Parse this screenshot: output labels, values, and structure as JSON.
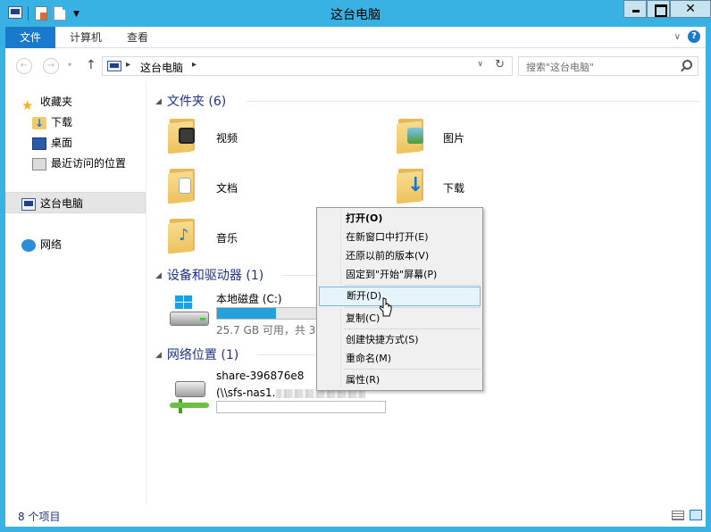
{
  "window": {
    "title": "这台电脑",
    "close_glyph": "✕"
  },
  "ribbon": {
    "tabs": [
      "文件",
      "计算机",
      "查看"
    ],
    "expand_glyph": "∨",
    "help_glyph": "?"
  },
  "navigation": {
    "back_glyph": "←",
    "forward_glyph": "→",
    "recent_glyph": "▾",
    "up_glyph": "↑",
    "path_separator": "▸",
    "path": [
      "这台电脑"
    ],
    "dropdown_glyph": "∨",
    "refresh_glyph": "↻",
    "search_placeholder": "搜索\"这台电脑\""
  },
  "nav_pane": {
    "favorites_label": "收藏夹",
    "favorites": [
      "下载",
      "桌面",
      "最近访问的位置"
    ],
    "this_pc_label": "这台电脑",
    "network_label": "网络"
  },
  "content": {
    "group_arrow": "◢",
    "groups": {
      "folders": "文件夹 (6)",
      "devices": "设备和驱动器 (1)",
      "network": "网络位置 (1)"
    },
    "folders": [
      "视频",
      "图片",
      "文档",
      "下载",
      "音乐"
    ],
    "drive": {
      "name": "本地磁盘 (C:)",
      "free_text": "25.7 GB 可用，共 39.",
      "used_fraction": 0.35
    },
    "network_location": {
      "name": "share-396876e8",
      "path": "(\\\\sfs-nas1."
    }
  },
  "context_menu": {
    "items": [
      "打开(O)",
      "在新窗口中打开(E)",
      "还原以前的版本(V)",
      "固定到\"开始\"屏幕(P)",
      "断开(D)",
      "复制(C)",
      "创建快捷方式(S)",
      "重命名(M)",
      "属性(R)"
    ],
    "highlighted": "断开(D)"
  },
  "status_bar": {
    "item_count": "8 个项目"
  },
  "colors": {
    "window_chrome": "#39b2e3",
    "ribbon_file_tab": "#1979ca",
    "group_header_text": "#1e3287",
    "drive_bar_fill": "#26a0da",
    "menu_highlight": "#e5f3fb"
  }
}
